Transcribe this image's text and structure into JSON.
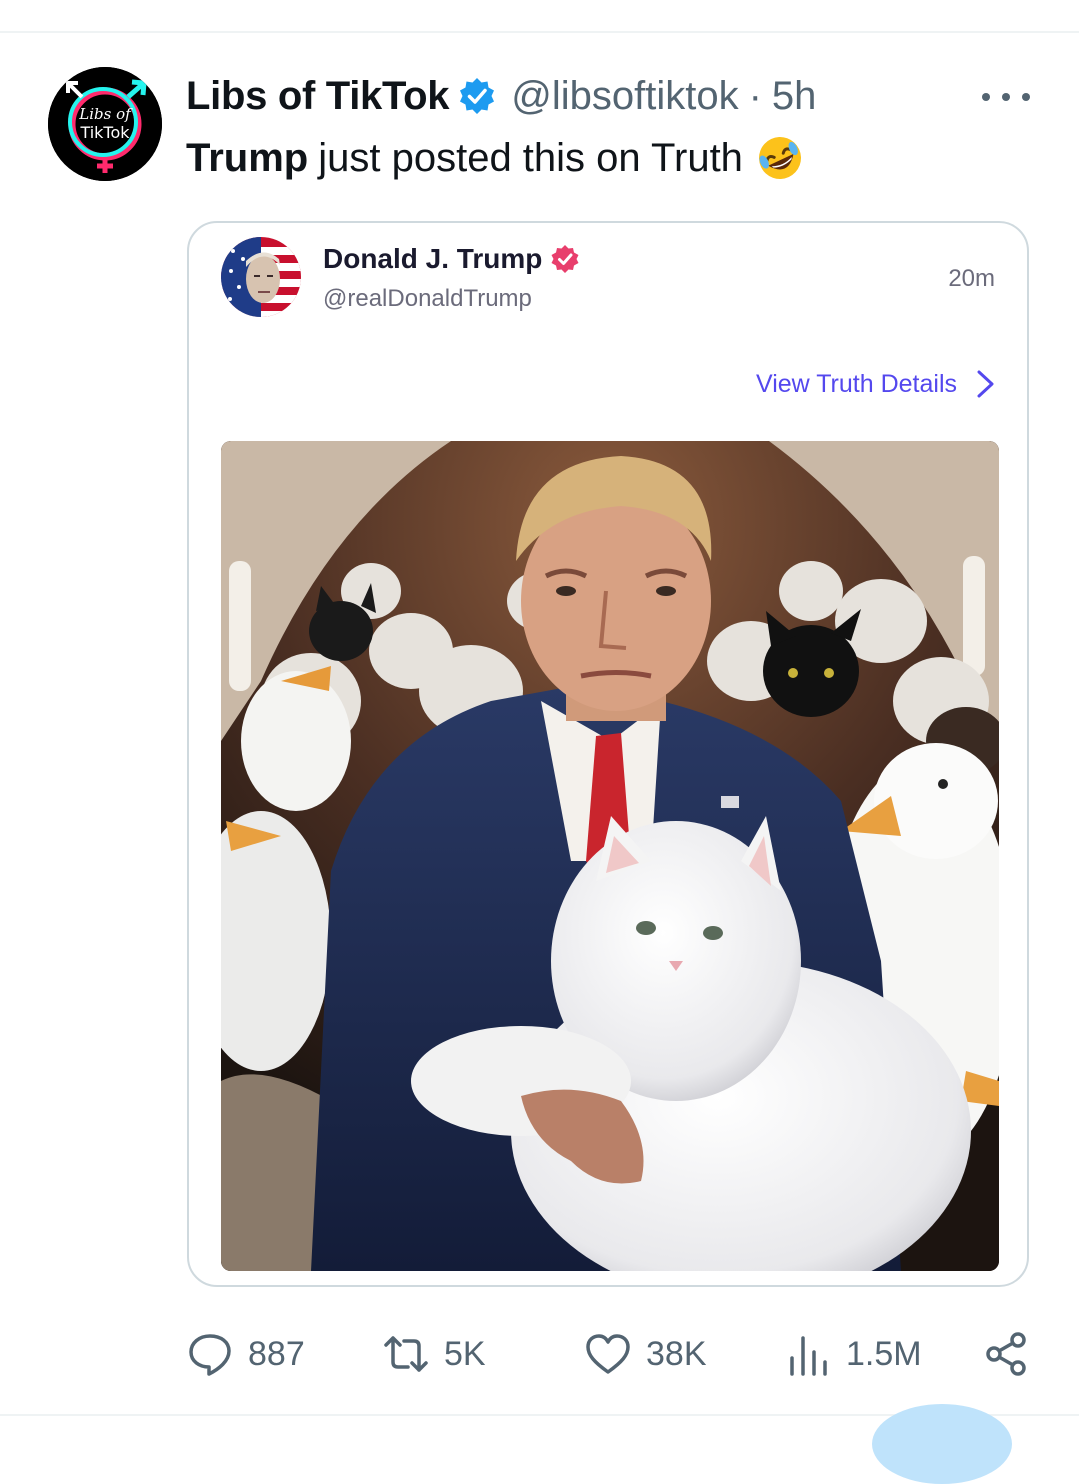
{
  "tweet": {
    "display_name": "Libs of TikTok",
    "handle": "@libsoftiktok",
    "separator": "·",
    "time": "5h",
    "text_bold": "Trump",
    "text_rest": "just posted this on Truth",
    "emoji": "rolling-on-floor-laughing-emoji",
    "avatar_text_line1": "Libs of",
    "avatar_text_line2": "TikTok"
  },
  "truth_card": {
    "name": "Donald J. Trump",
    "handle": "@realDonaldTrump",
    "time": "20m",
    "view_details": "View Truth Details"
  },
  "actions": {
    "replies": "887",
    "reposts": "5K",
    "likes": "38K",
    "views": "1.5M"
  },
  "colors": {
    "verified_blue": "#1d9bf0",
    "truth_badge_pink": "#e83e6c",
    "truth_link": "#5448ee",
    "muted_text": "#536471"
  }
}
